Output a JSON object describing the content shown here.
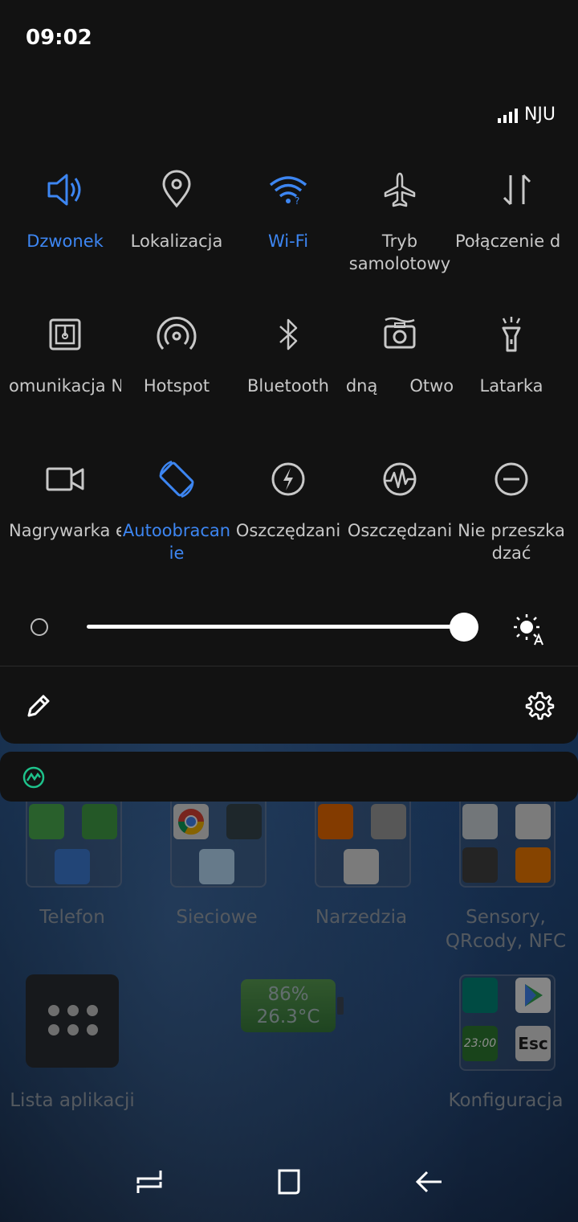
{
  "status": {
    "time": "09:02",
    "carrier": "NJU"
  },
  "tiles": [
    {
      "label": "Dzwonek",
      "icon": "speaker-icon",
      "active": true
    },
    {
      "label": "Lokalizacja",
      "icon": "location-pin-icon",
      "active": false
    },
    {
      "label": "Wi-Fi",
      "icon": "wifi-icon",
      "active": true
    },
    {
      "label": "Tryb samolotowy",
      "icon": "airplane-icon",
      "active": false
    },
    {
      "label": "Połączenie d",
      "icon": "data-arrows-icon",
      "active": false
    },
    {
      "label": "omunikacja N",
      "icon": "nfc-icon",
      "active": false
    },
    {
      "label": "Hotspot",
      "icon": "hotspot-icon",
      "active": false
    },
    {
      "label": "Bluetooth",
      "icon": "bluetooth-icon",
      "active": false
    },
    {
      "label": "dną      Otwo",
      "icon": "screenshot-camera-icon",
      "active": false
    },
    {
      "label": "Latarka",
      "icon": "flashlight-icon",
      "active": false
    },
    {
      "label": "Nagrywarka e",
      "icon": "video-camera-icon",
      "active": false
    },
    {
      "label": "Autoobracan ie",
      "icon": "rotate-icon",
      "active": true
    },
    {
      "label": "Oszczędzani",
      "icon": "power-saving-icon",
      "active": false
    },
    {
      "label": "Oszczędzani",
      "icon": "performance-icon",
      "active": false
    },
    {
      "label": "Nie przeszka dzać",
      "icon": "do-not-disturb-icon",
      "active": false
    }
  ],
  "brightness": {
    "level": 0.98
  },
  "home": {
    "folders": [
      "Telefon",
      "Sieciowe",
      "Narzedzia",
      "Sensory, QRcody, NFC"
    ],
    "app_list_label": "Lista aplikacji",
    "battery_percent": "86%",
    "battery_temp": "26.3°C",
    "config_label": "Konfiguracja",
    "widget_clock": "23:00",
    "widget_esc": "Esc"
  }
}
